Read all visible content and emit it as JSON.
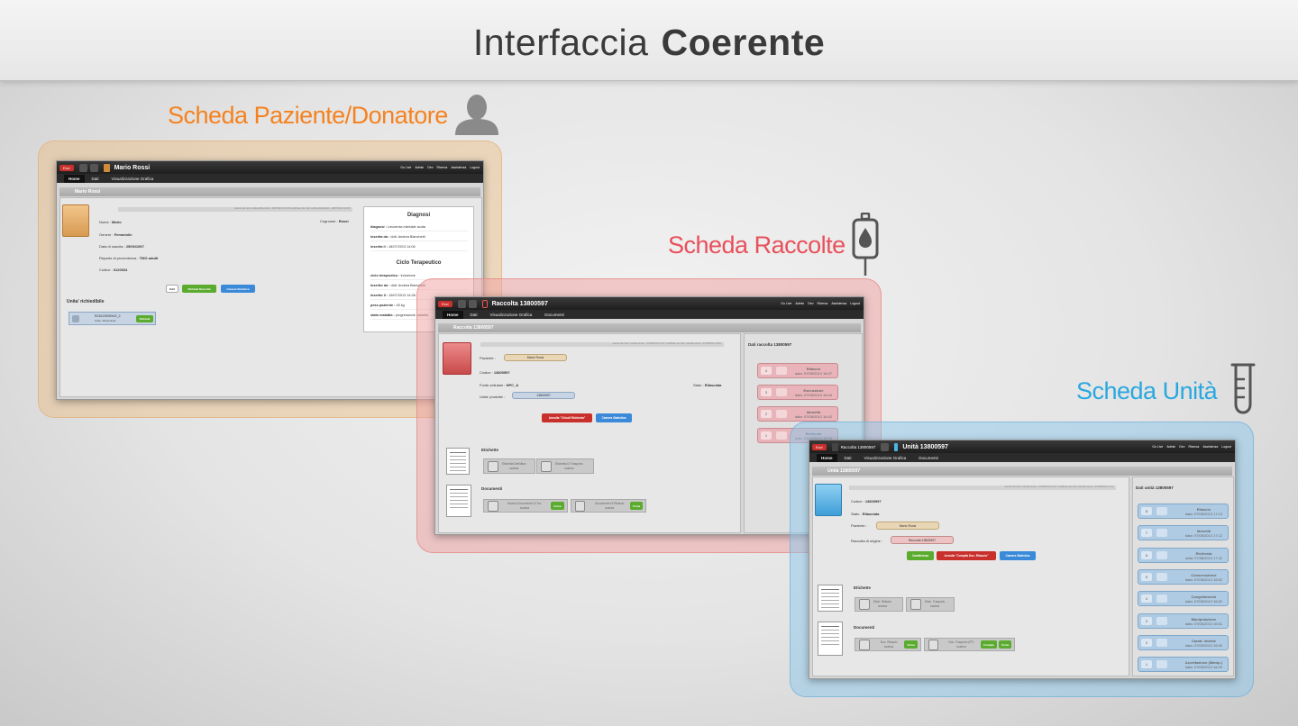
{
  "title": {
    "light": "Interfaccia",
    "bold": "Coerente"
  },
  "sections": {
    "paziente": "Scheda Paziente/Donatore",
    "raccolte": "Scheda Raccolte",
    "unita": "Scheda Unità"
  },
  "colors": {
    "orange": "#f58220",
    "red": "#e8505b",
    "blue": "#29a8e0"
  },
  "icons": {
    "paziente": "person-silhouette-icon",
    "raccolte": "blood-bag-icon",
    "unita": "test-tube-icon"
  },
  "tb_right": [
    "Go Live",
    "Admin",
    "Dev",
    "Ricerca",
    "Assistenza",
    "Logout"
  ],
  "esci": "Esci",
  "nav": {
    "home": "Home",
    "dati": "Dati",
    "vis": "Visualizzazione Grafica",
    "doc": "Documenti"
  },
  "s1": {
    "title": "Mario Rossi",
    "sub": "Mario Rossi",
    "meta": "inserito da: dott. Andrea Bianchetti - 18/07/2013 14:06    modificato da: dott. Andrea Bianchetti - 18/07/2013 14:06",
    "nome_l": "Nome :",
    "nome_v": "Mario",
    "cogn_l": "Cognome :",
    "cogn_v": "Rossi",
    "gen_l": "Genere :",
    "gen_v": "Femminile",
    "nasc_l": "Data di nascita :",
    "nasc_v": "25/06/1967",
    "rep_l": "Reparto di provenienza :",
    "rep_v": "TMO adulti",
    "cod_l": "Codice :",
    "cod_v": "0120034",
    "b_edit": "Edit",
    "b_rich": "Richiedi Raccolta",
    "b_cam": "Camera Statistica",
    "unita_h": "Unita' richiedibile",
    "unit_code": "R2161300594G_2",
    "unit_stato": "Stato: Manipolata",
    "unit_btn": "Richiedi",
    "diag_h": "Diagnosi",
    "diag": [
      [
        "diagnosi : ",
        "Leucemia mieloide acuta"
      ],
      [
        "inserita da : ",
        "dott. Andrea Bianchetti"
      ],
      [
        "inserita il : ",
        "18/07/2013 14:06"
      ]
    ],
    "ciclo_h": "Ciclo Terapeutico",
    "ciclo": [
      [
        "ciclo terapeutico : ",
        "induzione"
      ],
      [
        "inserito da : ",
        "dott. Andrea Bianchetti"
      ],
      [
        "inserito il : ",
        "18/07/2013 14:06"
      ],
      [
        "peso paziente : ",
        "45 kg"
      ],
      [
        "stato malattia : ",
        "progressione malattia"
      ]
    ]
  },
  "s2": {
    "title": "Raccolta 13800597",
    "sub": "Raccolta 13800597",
    "meta": "inserito da: dott. Camillo Amieri - 07/08/2013 16:47    modificato da: dott. Camillo Amieri - 07/08/2013 16:56",
    "paz_l": "Paziente :",
    "paz_v": "Mario Rossi",
    "cod_l": "Codice :",
    "cod_v": "13800597",
    "fonte_l": "Fonte cellulare :",
    "fonte_v": "HPC_A",
    "stato_l": "Stato :",
    "stato_v": "Rilasciata",
    "unit_l": "Unita' prodotte :",
    "unit_v": "13800597",
    "b_annulla": "Annulla \"Chiudi Richiesta\"",
    "b_cam": "Camera Statistica",
    "etich_h": "Etichette",
    "etich": [
      {
        "t": "Etichetta Definitiva",
        "s": "scarica"
      },
      {
        "t": "Etichetta Di Trasporto",
        "s": "scarica"
      }
    ],
    "doc_h": "Documenti",
    "docs": [
      {
        "t": "Modulo Documento Di Tra.",
        "s": "scarica",
        "b": "Firma"
      },
      {
        "t": "Documento Di Rilascio",
        "s": "scarica",
        "b": "Firma"
      }
    ],
    "side_h": "Dati raccolta 13800597",
    "tl": [
      {
        "n": "4",
        "t": "Rilascio",
        "d": "data: 07/08/2013 16:47"
      },
      {
        "n": "3",
        "t": "Esecuzione",
        "d": "data: 07/08/2013 16:44"
      },
      {
        "n": "2",
        "t": "Idoneità",
        "d": "data: 07/08/2013 16:42"
      },
      {
        "n": "1",
        "t": "Richiesta",
        "d": "data: 07/08/2013 16:39"
      }
    ]
  },
  "s3": {
    "bc": "Raccolta 13800597",
    "title": "Unità 13800597",
    "sub": "Unità 13800597",
    "meta": "inserito da: dott. Camillo Amieri - 07/08/2013 16:47    modificato da: dott. Camillo Amieri - 07/08/2013 17:13",
    "cod_l": "Codice :",
    "cod_v": "13800597",
    "stato_l": "Stato :",
    "stato_v": "Rilasciata",
    "paz_l": "Paziente :",
    "paz_v": "Mario Rossi",
    "orig_l": "Raccolta di origine :",
    "orig_v": "Raccolta 13800597",
    "b_car": "Caratterizza",
    "b_ann": "Annulla \"Compila Doc. Rilascio\"",
    "b_cam": "Camera Statistica",
    "etich_h": "Etichette",
    "etich": [
      {
        "t": "Etich. Rilascio",
        "s": "scarica"
      },
      {
        "t": "Etich. Trasporto",
        "s": "scarica"
      }
    ],
    "doc_h": "Documenti",
    "docs": [
      {
        "t": "Doc. Rilascio",
        "s": "scarica",
        "b": [
          "Firma"
        ]
      },
      {
        "t": "Doc. Trasporto (FP)",
        "s": "scarica",
        "b": [
          "Compila",
          "Firma"
        ]
      }
    ],
    "side_h": "Dati unità 13800597",
    "tl": [
      {
        "n": "8",
        "t": "Rilascio",
        "d": "data: 07/08/2013 17:13"
      },
      {
        "n": "7",
        "t": "Idoneità",
        "d": "data: 07/08/2013 17:12"
      },
      {
        "n": "6",
        "t": "Richiesta",
        "d": "data: 07/08/2013 17:11"
      },
      {
        "n": "5",
        "t": "Conservazione",
        "d": "data: 07/08/2013 16:52"
      },
      {
        "n": "4",
        "t": "Congelamento",
        "d": "data: 07/08/2013 16:52"
      },
      {
        "n": "3",
        "t": "Manipolazione",
        "d": "data: 07/08/2013 16:51"
      },
      {
        "n": "2",
        "t": "Caratt. Iniziale",
        "d": "data: 07/08/2013 16:50"
      },
      {
        "n": "1",
        "t": "Accettazione (Manip.)",
        "d": "data: 07/08/2013 16:49"
      }
    ]
  }
}
